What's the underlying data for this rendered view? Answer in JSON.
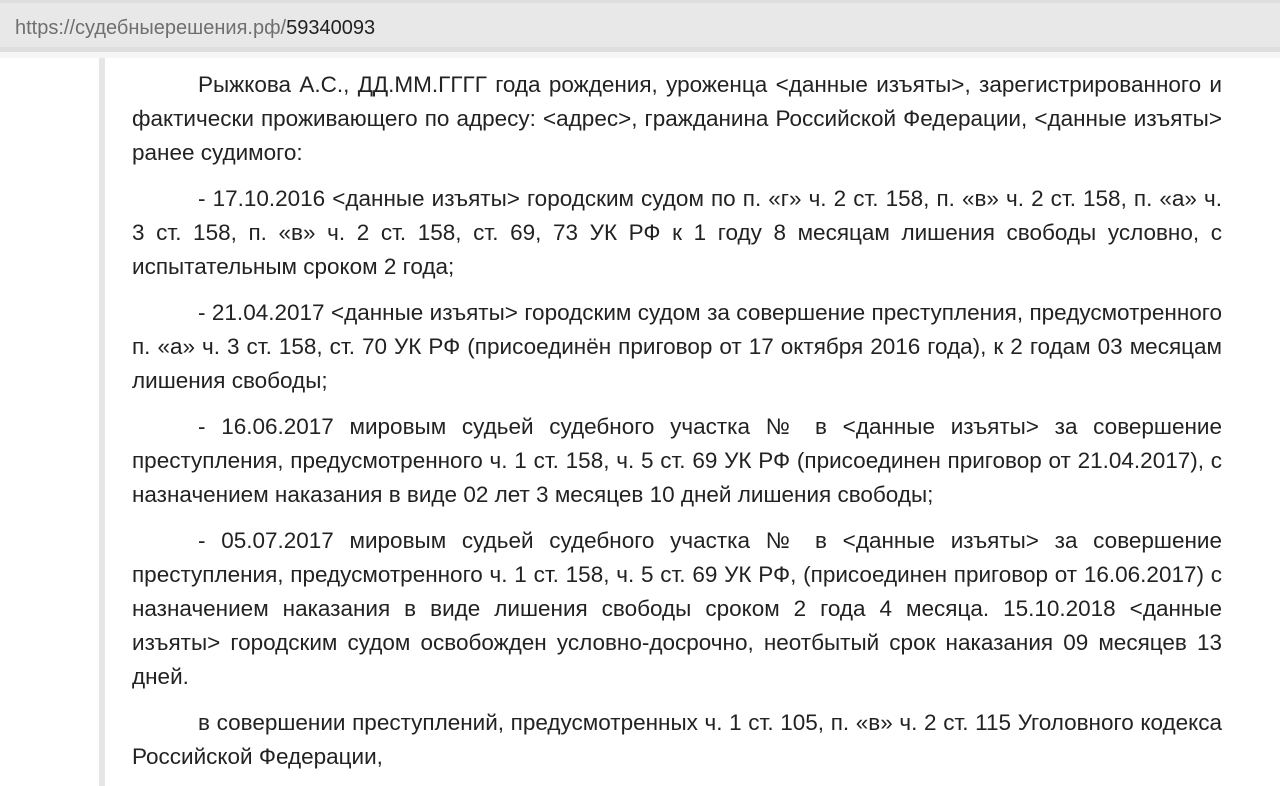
{
  "browser": {
    "url_host": "https://судебныерешения.рф/",
    "url_path": "59340093"
  },
  "document": {
    "paragraphs": [
      "Рыжкова А.С., ДД.ММ.ГГГГ года рождения, уроженца <данные изъяты>, зарегистрированного и фактически проживающего по адресу: <адрес>, гражданина Российской Федерации, <данные изъяты> ранее судимого:",
      "- 17.10.2016 <данные изъяты> городским судом по п. «г» ч. 2 ст. 158, п. «в» ч. 2 ст. 158, п. «а» ч. 3 ст. 158, п. «в» ч. 2 ст. 158, ст. 69, 73 УК РФ к 1 году 8 месяцам лишения свободы условно, с испытательным сроком 2 года;",
      "- 21.04.2017 <данные изъяты> городским судом за совершение преступления, предусмотренного п. «а» ч. 3 ст. 158, ст. 70 УК РФ (присоединён приговор от 17 октября 2016 года), к 2 годам 03 месяцам лишения свободы;",
      "- 16.06.2017 мировым судьей судебного участка № в <данные изъяты> за совершение преступления, предусмотренного ч. 1 ст. 158, ч. 5 ст. 69 УК РФ (присоединен приговор от 21.04.2017), с назначением наказания в виде 02 лет 3 месяцев 10 дней лишения свободы;",
      "- 05.07.2017 мировым судьей судебного участка № в <данные изъяты> за совершение преступления, предусмотренного ч. 1 ст. 158, ч. 5 ст. 69 УК РФ, (присоединен приговор от 16.06.2017) с назначением наказания в виде лишения свободы сроком 2 года 4 месяца. 15.10.2018 <данные изъяты> городским судом освобожден условно-досрочно, неотбытый срок наказания 09 месяцев 13 дней.",
      "в совершении преступлений, предусмотренных ч. 1 ст. 105, п. «в» ч. 2 ст. 115 Уголовного кодекса Российской Федерации,"
    ]
  }
}
